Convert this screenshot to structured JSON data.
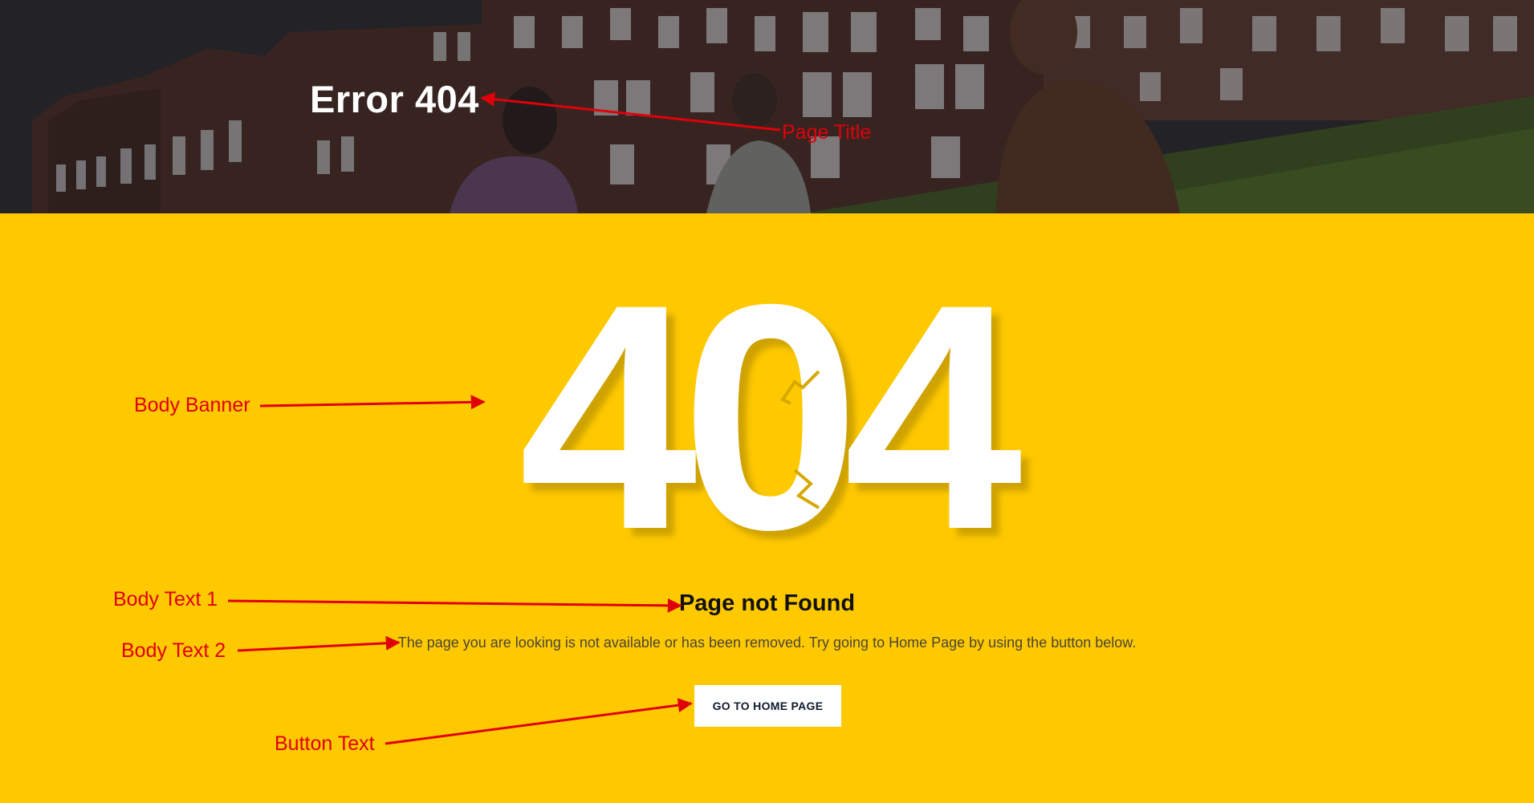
{
  "header": {
    "page_title": "Error 404"
  },
  "main": {
    "banner_text": "404",
    "heading": "Page not Found",
    "message": "The page you are looking is not available or has been removed. Try going to Home Page by using the button below.",
    "button_label": "GO TO HOME PAGE"
  },
  "annotations": {
    "page_title": "Page Title",
    "body_banner": "Body Banner",
    "body_text_1": "Body Text 1",
    "body_text_2": "Body Text 2",
    "button_text": "Button Text"
  },
  "colors": {
    "accent_yellow": "#ffc900",
    "annotation_red": "#e0000a",
    "button_text": "#0f1a2e"
  }
}
